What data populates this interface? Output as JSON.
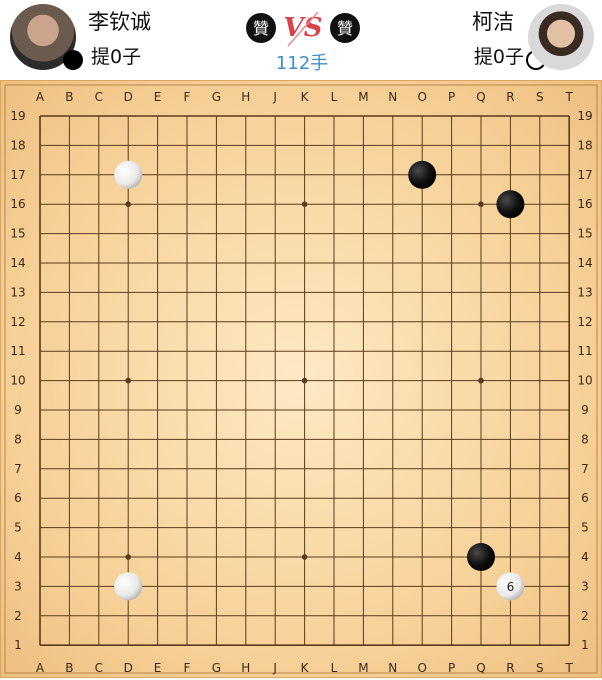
{
  "players": {
    "black": {
      "name": "李钦诚",
      "captures": "提0子",
      "avatar": "player-avatar"
    },
    "white": {
      "name": "柯洁",
      "captures": "提0子",
      "avatar": "player-avatar"
    }
  },
  "header": {
    "move_count": "112手",
    "logo_glyph": "贊",
    "vs_label": "VS"
  },
  "board": {
    "size": 19,
    "columns": [
      "A",
      "B",
      "C",
      "D",
      "E",
      "F",
      "G",
      "H",
      "J",
      "K",
      "L",
      "M",
      "N",
      "O",
      "P",
      "Q",
      "R",
      "S",
      "T"
    ],
    "rows": [
      "19",
      "18",
      "17",
      "16",
      "15",
      "14",
      "13",
      "12",
      "11",
      "10",
      "9",
      "8",
      "7",
      "6",
      "5",
      "4",
      "3",
      "2",
      "1"
    ],
    "star_points": [
      "D16",
      "K16",
      "Q16",
      "D10",
      "K10",
      "Q10",
      "D4",
      "K4",
      "Q4"
    ],
    "stones": [
      {
        "point": "D17",
        "color": "white",
        "label": ""
      },
      {
        "point": "O17",
        "color": "black",
        "label": ""
      },
      {
        "point": "R16",
        "color": "black",
        "label": ""
      },
      {
        "point": "Q4",
        "color": "black",
        "label": ""
      },
      {
        "point": "D3",
        "color": "white",
        "label": ""
      },
      {
        "point": "R3",
        "color": "white",
        "label": "6"
      }
    ]
  },
  "colors": {
    "board": "#f6cf95",
    "line": "#5a3b1c",
    "move_count": "#3f8fc4",
    "vs": "#d8424a"
  }
}
